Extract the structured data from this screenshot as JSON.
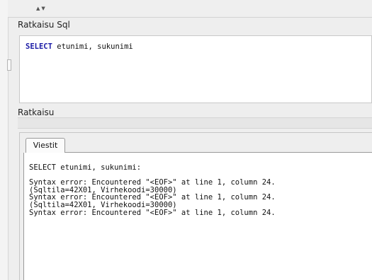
{
  "sql_section": {
    "label": "Ratkaisu Sql",
    "query_keyword": "SELECT",
    "query_rest": " etunimi, sukunimi"
  },
  "result_section": {
    "label": "Ratkaisu"
  },
  "messages_panel": {
    "tab_label": "Viestit",
    "output": "SELECT etunimi, sukunimi:\n\nSyntax error: Encountered \"<EOF>\" at line 1, column 24.\n(Sqltila=42X01, Virhekoodi=30000)\nSyntax error: Encountered \"<EOF>\" at line 1, column 24.\n(Sqltila=42X01, Virhekoodi=30000)\nSyntax error: Encountered \"<EOF>\" at line 1, column 24."
  },
  "icons": {
    "splitter": "sort-arrows-icon"
  }
}
